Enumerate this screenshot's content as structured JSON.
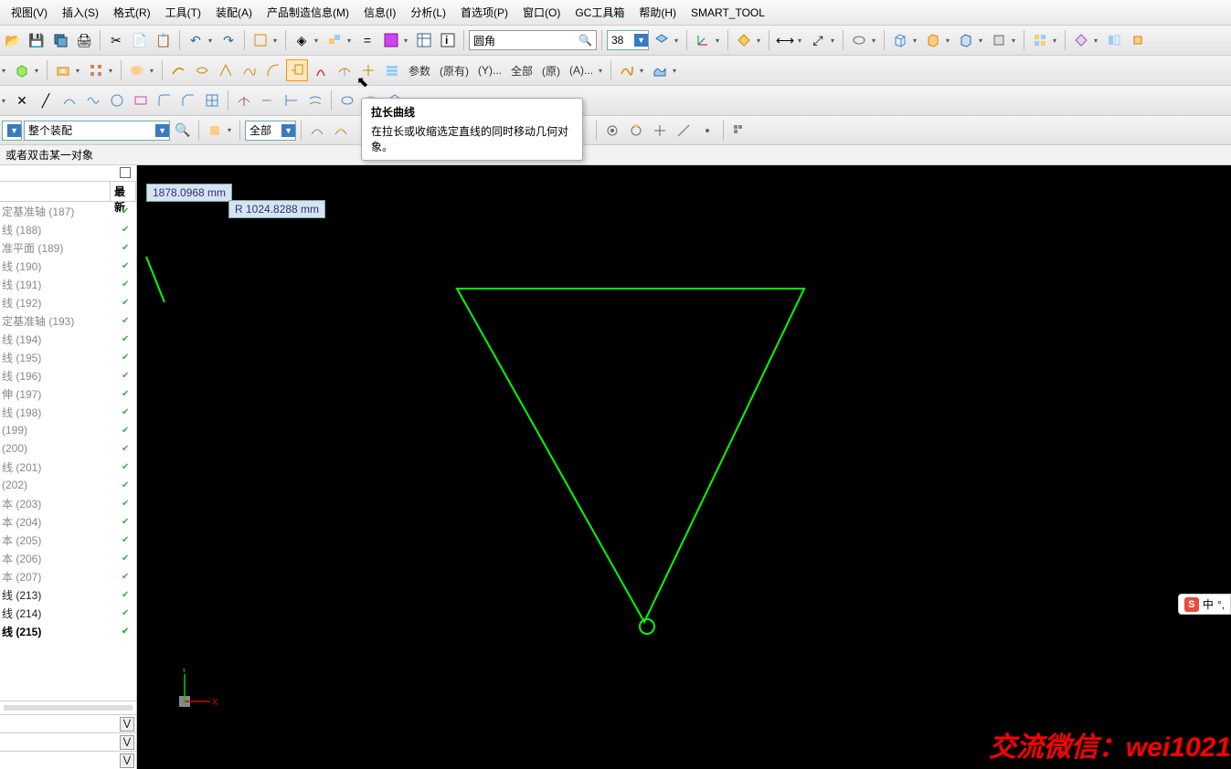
{
  "menu": [
    "视图(V)",
    "插入(S)",
    "格式(R)",
    "工具(T)",
    "装配(A)",
    "产品制造信息(M)",
    "信息(I)",
    "分析(L)",
    "首选项(P)",
    "窗口(O)",
    "GC工具箱",
    "帮助(H)",
    "SMART_TOOL"
  ],
  "toolbar1": {
    "combo1_text": "圆角",
    "num_field": "38"
  },
  "toolbar2": {
    "params": "参数",
    "existing": "(原有)",
    "y": "(Y)...",
    "all": "全部",
    "orig": "(原)",
    "a": "(A)..."
  },
  "filter_row": {
    "scope": "整个装配",
    "mode": "全部"
  },
  "prompt": "或者双击某一对象",
  "tree": {
    "col_latest": "最新",
    "items": [
      {
        "label": "定基准轴 (187)",
        "tick": true,
        "style": "dim"
      },
      {
        "label": "线 (188)",
        "tick": true,
        "style": "dim"
      },
      {
        "label": "准平面 (189)",
        "tick": true,
        "style": "dim"
      },
      {
        "label": "线 (190)",
        "tick": true,
        "style": "dim"
      },
      {
        "label": "线 (191)",
        "tick": true,
        "style": "dim"
      },
      {
        "label": "线 (192)",
        "tick": true,
        "style": "dim"
      },
      {
        "label": "定基准轴 (193)",
        "tick": true,
        "style": "dim"
      },
      {
        "label": "线 (194)",
        "tick": true,
        "style": "dim"
      },
      {
        "label": "线 (195)",
        "tick": true,
        "style": "dim"
      },
      {
        "label": "线 (196)",
        "tick": true,
        "style": "dim"
      },
      {
        "label": "伸 (197)",
        "tick": true,
        "style": "dim"
      },
      {
        "label": "线 (198)",
        "tick": true,
        "style": "dim"
      },
      {
        "label": " (199)",
        "tick": true,
        "style": "dim"
      },
      {
        "label": " (200)",
        "tick": true,
        "style": "dim"
      },
      {
        "label": "线 (201)",
        "tick": true,
        "style": "dim"
      },
      {
        "label": " (202)",
        "tick": true,
        "style": "dim"
      },
      {
        "label": "本 (203)",
        "tick": true,
        "style": "dim"
      },
      {
        "label": "本 (204)",
        "tick": true,
        "style": "dim"
      },
      {
        "label": "本 (205)",
        "tick": true,
        "style": "dim"
      },
      {
        "label": "本 (206)",
        "tick": true,
        "style": "dim"
      },
      {
        "label": "本 (207)",
        "tick": true,
        "style": "dim"
      },
      {
        "label": "线 (213)",
        "tick": true,
        "style": "dark"
      },
      {
        "label": "线 (214)",
        "tick": true,
        "style": "dark"
      },
      {
        "label": "线 (215)",
        "tick": true,
        "style": "active"
      }
    ]
  },
  "measurements": {
    "m1": "1878.0968 mm",
    "m2": "R 1024.8288 mm"
  },
  "tooltip": {
    "title": "拉长曲线",
    "desc": "在拉长或收缩选定直线的同时移动几何对象。"
  },
  "watermark": "交流微信：wei1021",
  "ime": {
    "s": "S",
    "lang": "中",
    "punct": "°,"
  },
  "triad": {
    "x": "X",
    "y": "Y"
  }
}
